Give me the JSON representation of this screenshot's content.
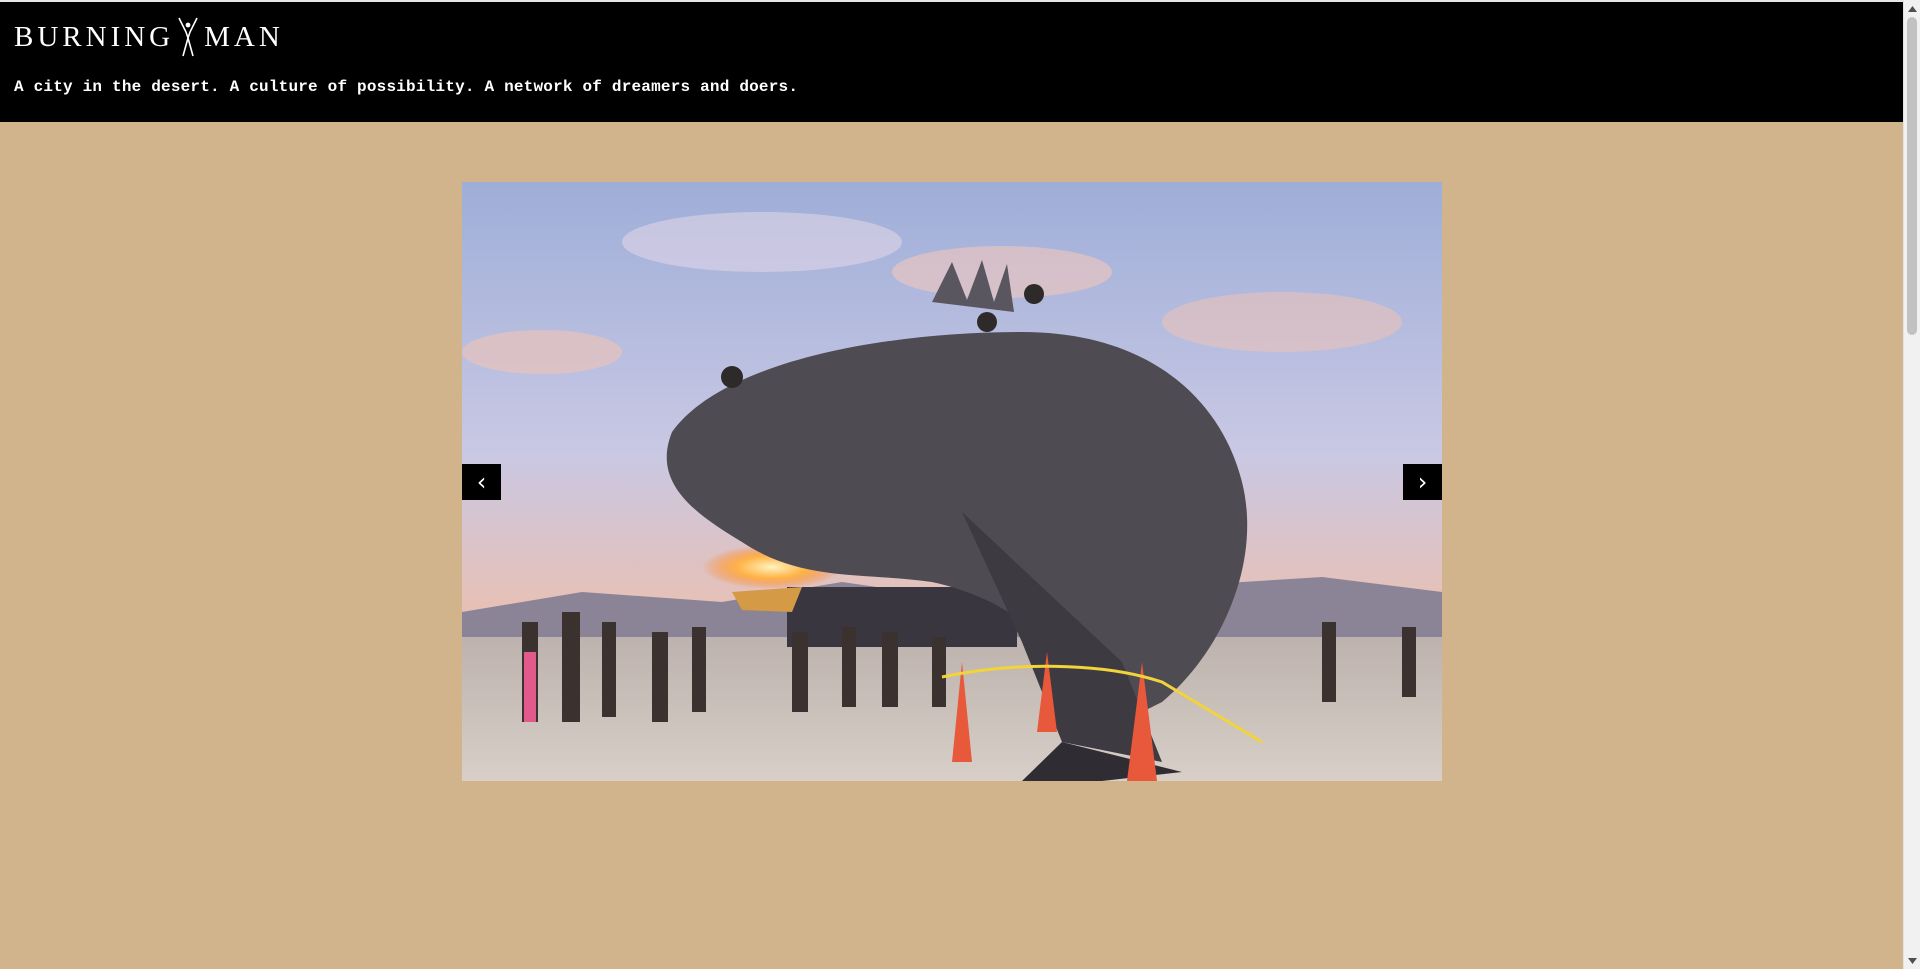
{
  "header": {
    "logo_left": "BURNING",
    "logo_right": "MAN",
    "tagline": "A city in the desert. A culture of possibility. A network of dreamers and doers."
  },
  "slideshow": {
    "prev_label": "‹",
    "next_label": "›",
    "photo_icon": "art-car-dragon-sculpture-photo"
  },
  "colors": {
    "page_background": "#d2b48c",
    "header_background": "#000000",
    "header_text": "#ffffff"
  }
}
